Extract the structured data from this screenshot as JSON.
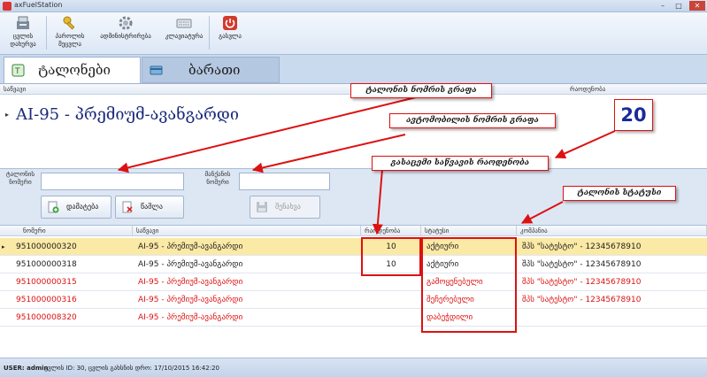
{
  "window": {
    "title": "axFuelStation",
    "minimize": "–",
    "maximize": "□",
    "close": "✕"
  },
  "toolbar": {
    "items": [
      {
        "label": "ცვლის დახურვა",
        "icon": "register-icon"
      },
      {
        "label": "პაროლის შეცვლა",
        "icon": "key-icon"
      },
      {
        "label": "ადმინისტრირება",
        "icon": "gear-icon"
      },
      {
        "label": "კლავიატურა",
        "icon": "keyboard-icon"
      },
      {
        "label": "გასვლა",
        "icon": "power-icon"
      }
    ]
  },
  "tabs": [
    {
      "label": "ტალონები",
      "icon": "coupon-tab-icon",
      "active": true
    },
    {
      "label": "ბარათი",
      "icon": "card-tab-icon",
      "active": false
    }
  ],
  "panel": {
    "col_product": "საწვავი",
    "col_quantity": "რაოდენობა",
    "product": "AI-95 - პრემიუმ-ავანგარდი",
    "row_pointer": "▸"
  },
  "form": {
    "coupon_number_label": "ტალონის ნომერი",
    "car_number_label": "მანქანის ნომერი",
    "coupon_number_value": "",
    "car_number_value": "",
    "add_button": "დამატება",
    "delete_button": "წაშლა",
    "save_button": "შენახვა"
  },
  "table": {
    "columns": [
      "ნომერი",
      "საწვავი",
      "რაოდენობა",
      "სტატუსი",
      "კომპანია"
    ],
    "rows": [
      {
        "number": "951000000320",
        "fuel": "AI-95 - პრემიუმ-ავანგარდი",
        "qty": "10",
        "status": "აქტიური",
        "company": "შპს \"სატესტო\" - 12345678910",
        "selected": true,
        "red": false
      },
      {
        "number": "951000000318",
        "fuel": "AI-95 - პრემიუმ-ავანგარდი",
        "qty": "10",
        "status": "აქტიური",
        "company": "შპს \"სატესტო\" - 12345678910",
        "selected": false,
        "red": false
      },
      {
        "number": "951000000315",
        "fuel": "AI-95 - პრემიუმ-ავანგარდი",
        "qty": "",
        "status": "გამოყენებული",
        "company": "შპს \"სატესტო\" - 12345678910",
        "selected": false,
        "red": true
      },
      {
        "number": "951000000316",
        "fuel": "AI-95 - პრემიუმ-ავანგარდი",
        "qty": "",
        "status": "შეჩერებული",
        "company": "შპს \"სატესტო\" - 12345678910",
        "selected": false,
        "red": true
      },
      {
        "number": "951000008320",
        "fuel": "AI-95 - პრემიუმ-ავანგარდი",
        "qty": "",
        "status": "დაბეჭდილი",
        "company": "",
        "selected": false,
        "red": true
      }
    ],
    "row_pointer": "▸"
  },
  "annotations": {
    "coupon_number_field": "ტალონის ნომრის გრაფა",
    "car_number_field": "ავტომობილის ნომრის გრაფა",
    "fuel_quantity": "გასაცემი საწვავის რაოდენობა",
    "coupon_status": "ტალონის სტატუსი",
    "quantity_value": "20"
  },
  "statusbar": {
    "user": "USER: admin",
    "info": "ცვლის ID: 30, ცვლის გახსნის დრო: 17/10/2015 16:42:20"
  },
  "colors": {
    "accent_red": "#d11111",
    "selected_row": "#fbe9a6",
    "product_text": "#1a2a7a",
    "chrome": "#c9d9ee"
  }
}
